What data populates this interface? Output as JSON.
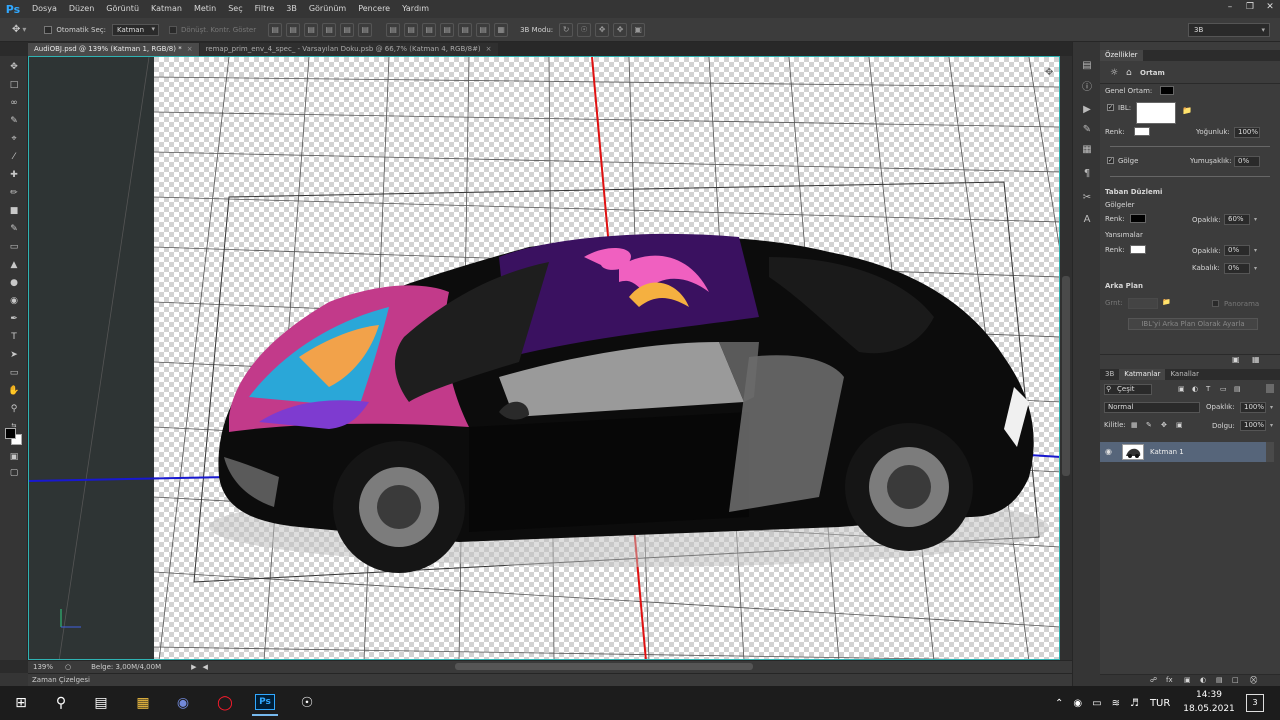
{
  "app": {
    "logo": "Ps"
  },
  "menu": [
    "Dosya",
    "Düzen",
    "Görüntü",
    "Katman",
    "Metin",
    "Seç",
    "Filtre",
    "3B",
    "Görünüm",
    "Pencere",
    "Yardım"
  ],
  "options": {
    "auto_select_label": "Otomatik Seç:",
    "auto_select_value": "Katman",
    "transform_label": "Dönüşt. Kontr. Göster",
    "mode_label": "3B Modu:",
    "workspace": "3B"
  },
  "tabs": [
    {
      "label": "AudiOBJ.psd @ 139% (Katman 1, RGB/8) *",
      "close": "×",
      "active": true
    },
    {
      "label": "remap_prim_env_4_spec_ - Varsayılan Doku.psb @ 66,7% (Katman 4, RGB/8#)",
      "close": "×",
      "active": false
    }
  ],
  "statusbar": {
    "zoom": "139%",
    "doc_info": "Belge: 3,00M/4,00M"
  },
  "timeline_label": "Zaman Çizelgesi",
  "properties": {
    "tab": "Özellikler",
    "section": "Ortam",
    "global_ambient": "Genel Ortam:",
    "ibl": "IBL:",
    "color": "Renk:",
    "intensity_label": "Yoğunluk:",
    "intensity_value": "100%",
    "shadow": "Gölge",
    "softness_label": "Yumuşaklık:",
    "softness_value": "0%",
    "ground_plane": "Taban Düzlemi",
    "shadows": "Gölgeler",
    "shadow_color": "Renk:",
    "shadow_opacity_label": "Opaklık:",
    "shadow_opacity_value": "60%",
    "reflections": "Yansımalar",
    "refl_color": "Renk:",
    "refl_opacity_label": "Opaklık:",
    "refl_opacity_value": "0%",
    "roughness_label": "Kabalık:",
    "roughness_value": "0%",
    "background": "Arka Plan",
    "bg_label": "Grnt:",
    "panorama": "Panorama",
    "set_ibl_button": "IBL'yi Arka Plan Olarak Ayarla"
  },
  "layers": {
    "tabs": [
      "3B",
      "Katmanlar",
      "Kanallar"
    ],
    "filter": "Çeşit",
    "blend_mode": "Normal",
    "opacity_label": "Opaklık:",
    "opacity_value": "100%",
    "lock_label": "Kilitle:",
    "fill_label": "Dolgu:",
    "fill_value": "100%",
    "items": [
      {
        "name": "Katman 1"
      }
    ]
  },
  "taskbar": {
    "lang": "TUR",
    "time": "14:39",
    "date": "18.05.2021",
    "notifications": "3"
  },
  "colors": {
    "accent_blue": "#31a8ff",
    "canvas_border": "#2fb3b3",
    "axis_red": "#e01010",
    "axis_blue": "#1818d0",
    "car_roof_purple": "#3a1160",
    "selected_layer": "#56657a"
  }
}
